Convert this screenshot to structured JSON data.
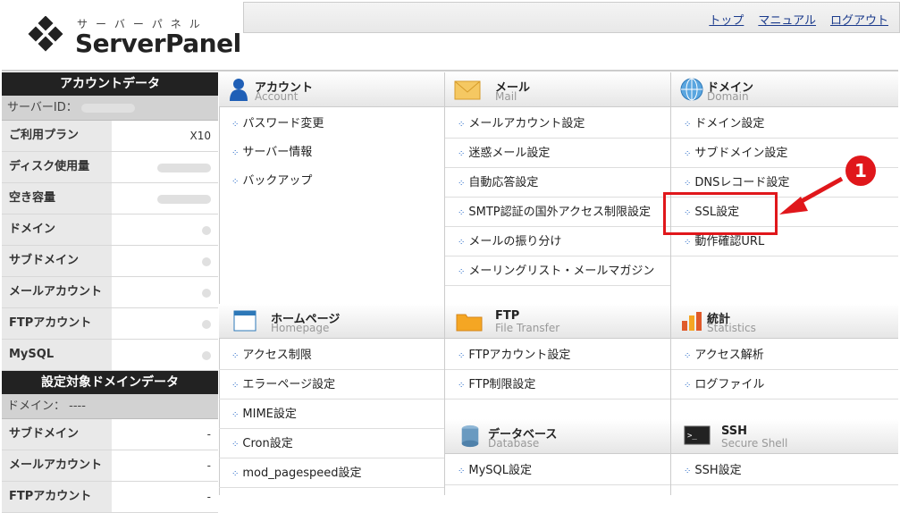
{
  "logo": {
    "kana": "サーバーパネル",
    "name": "ServerPanel"
  },
  "nav": {
    "top": "トップ",
    "manual": "マニュアル",
    "logout": "ログアウト"
  },
  "account_data": {
    "title": "アカウントデータ",
    "server_id_label": "サーバーID：",
    "rows": [
      {
        "label": "ご利用プラン",
        "value": "X10"
      },
      {
        "label": "ディスク使用量",
        "value": ""
      },
      {
        "label": "空き容量",
        "value": ""
      },
      {
        "label": "ドメイン",
        "value": ""
      },
      {
        "label": "サブドメイン",
        "value": ""
      },
      {
        "label": "メールアカウント",
        "value": ""
      },
      {
        "label": "FTPアカウント",
        "value": ""
      },
      {
        "label": "MySQL",
        "value": ""
      }
    ]
  },
  "domain_data": {
    "title": "設定対象ドメインデータ",
    "domain_label": "ドメイン： ----",
    "rows": [
      {
        "label": "サブドメイン",
        "value": "-"
      },
      {
        "label": "メールアカウント",
        "value": "-"
      },
      {
        "label": "FTPアカウント",
        "value": "-"
      }
    ]
  },
  "sections": {
    "account": {
      "title": "アカウント",
      "sub": "Account",
      "items": [
        "パスワード変更",
        "サーバー情報",
        "バックアップ"
      ]
    },
    "mail": {
      "title": "メール",
      "sub": "Mail",
      "items": [
        "メールアカウント設定",
        "迷惑メール設定",
        "自動応答設定",
        "SMTP認証の国外アクセス制限設定",
        "メールの振り分け",
        "メーリングリスト・メールマガジン"
      ]
    },
    "domain": {
      "title": "ドメイン",
      "sub": "Domain",
      "items": [
        "ドメイン設定",
        "サブドメイン設定",
        "DNSレコード設定",
        "SSL設定",
        "動作確認URL"
      ]
    },
    "homepage": {
      "title": "ホームページ",
      "sub": "Homepage",
      "items": [
        "アクセス制限",
        "エラーページ設定",
        "MIME設定",
        "Cron設定",
        "mod_pagespeed設定"
      ]
    },
    "ftp": {
      "title": "FTP",
      "sub": "File Transfer",
      "items": [
        "FTPアカウント設定",
        "FTP制限設定"
      ]
    },
    "stats": {
      "title": "統計",
      "sub": "Statistics",
      "items": [
        "アクセス解析",
        "ログファイル"
      ]
    },
    "database": {
      "title": "データベース",
      "sub": "Database",
      "items": [
        "MySQL設定"
      ]
    },
    "ssh": {
      "title": "SSH",
      "sub": "Secure Shell",
      "items": [
        "SSH設定"
      ]
    }
  },
  "annotation": {
    "badge": "1",
    "color": "#e0171b"
  }
}
